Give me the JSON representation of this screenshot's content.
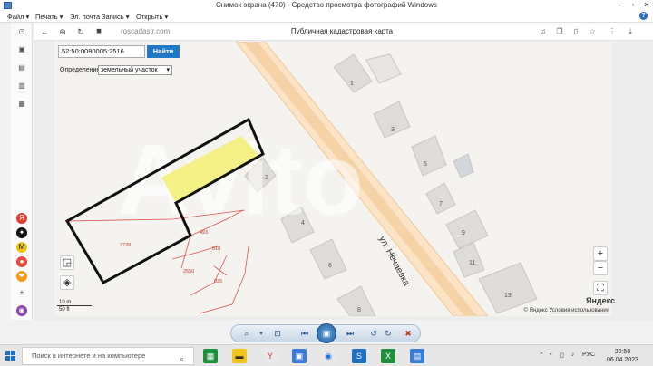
{
  "window": {
    "title": "Снимок экрана (470) - Средство просмотра фотографий Windows",
    "minimize": "–",
    "maximize": "▫",
    "close": "✕"
  },
  "menubar": {
    "items": [
      "Файл ▾",
      "Печать ▾",
      "Эл. почта",
      "Запись ▾",
      "Открыть ▾"
    ],
    "help": "?"
  },
  "browser": {
    "url": "roscadastr.com",
    "page_title": "Публичная кадастровая карта",
    "back": "←",
    "home": "⊕",
    "lock": "🔒",
    "menu": "⋮",
    "download": "⤓"
  },
  "search": {
    "value": "52:50:0080005:2516",
    "button": "Найти",
    "definition_label": "Определение",
    "definition_value": "земельный участок"
  },
  "map": {
    "street": "ул. Нечаевка",
    "houses": [
      "1",
      "2",
      "3",
      "4",
      "5",
      "6",
      "7",
      "8",
      "9",
      "11",
      "13"
    ],
    "parcels": [
      "2739",
      "493",
      "518",
      "2550",
      "935"
    ],
    "watermark": "Avito",
    "scale_m": "10 m",
    "scale_ft": "50 ft",
    "zoom_in": "+",
    "zoom_out": "−",
    "attribution_c": "© Яндекс",
    "attribution_terms": "Условия использования",
    "yandex": "Яндекс",
    "parcel_highlight_color": "#f5f07a"
  },
  "taskbar": {
    "search_placeholder": "Поиск в интернете и на компьютере",
    "lang": "РУС",
    "time": "20:50",
    "date": "06.04.2023"
  }
}
